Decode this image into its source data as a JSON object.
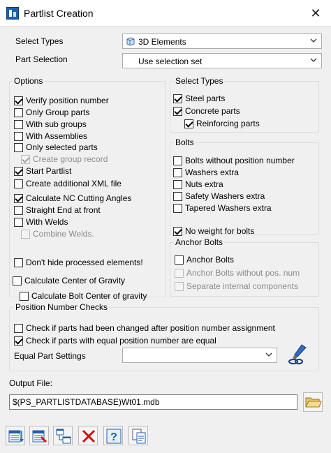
{
  "window": {
    "title": "Partlist Creation"
  },
  "top": {
    "select_types_label": "Select Types",
    "select_types_value": "3D Elements",
    "part_selection_label": "Part Selection",
    "part_selection_value": "Use selection set"
  },
  "options": {
    "title": "Options",
    "items": [
      {
        "label": "Verify position number",
        "checked": true,
        "enabled": true
      },
      {
        "label": "Only Group parts",
        "checked": false,
        "enabled": true
      },
      {
        "label": "With sub groups",
        "checked": false,
        "enabled": true
      },
      {
        "label": "With Assemblies",
        "checked": false,
        "enabled": true
      },
      {
        "label": "Only selected parts",
        "checked": false,
        "enabled": true
      },
      {
        "label": "Create group record",
        "checked": true,
        "enabled": false
      },
      {
        "label": "Start Partlist",
        "checked": true,
        "enabled": true
      },
      {
        "label": "Create additional XML file",
        "checked": false,
        "enabled": true
      },
      {
        "label": "Calculate NC Cutting Angles",
        "checked": true,
        "enabled": true
      },
      {
        "label": "Straight End at front",
        "checked": false,
        "enabled": true
      },
      {
        "label": "With Welds",
        "checked": false,
        "enabled": true
      },
      {
        "label": "Combine Welds.",
        "checked": false,
        "enabled": false
      },
      {
        "label": "Don't hide processed elements!",
        "checked": false,
        "enabled": true
      },
      {
        "label": "Calculate Center of Gravity",
        "checked": false,
        "enabled": true
      },
      {
        "label": "Calculate Bolt Center of gravity",
        "checked": false,
        "enabled": true
      }
    ]
  },
  "select_types": {
    "title": "Select Types",
    "items": [
      {
        "label": "Steel parts",
        "checked": true,
        "enabled": true
      },
      {
        "label": "Concrete parts",
        "checked": true,
        "enabled": true
      },
      {
        "label": "Reinforcing parts",
        "checked": true,
        "enabled": true
      }
    ]
  },
  "bolts": {
    "title": "Bolts",
    "items": [
      {
        "label": "Bolts without position number",
        "checked": false,
        "enabled": true
      },
      {
        "label": "Washers extra",
        "checked": false,
        "enabled": true
      },
      {
        "label": "Nuts extra",
        "checked": false,
        "enabled": true
      },
      {
        "label": "Safety Washers extra",
        "checked": false,
        "enabled": true
      },
      {
        "label": "Tapered Washers extra",
        "checked": false,
        "enabled": true
      },
      {
        "label": "No weight for bolts",
        "checked": true,
        "enabled": true
      }
    ]
  },
  "anchor_bolts": {
    "title": "Anchor Bolts",
    "items": [
      {
        "label": "Anchor Bolts",
        "checked": false,
        "enabled": true
      },
      {
        "label": "Anchor Bolts without pos. num",
        "checked": false,
        "enabled": false
      },
      {
        "label": "Separate internal components",
        "checked": false,
        "enabled": false
      }
    ]
  },
  "position_checks": {
    "title": "Position Number Checks",
    "items": [
      {
        "label": "Check if parts had been changed after position number assignment",
        "checked": false,
        "enabled": true
      },
      {
        "label": "Check if parts with equal position number are equal",
        "checked": true,
        "enabled": true
      }
    ],
    "equal_part_settings_label": "Equal Part Settings",
    "equal_part_settings_value": ""
  },
  "output": {
    "label": "Output File:",
    "value": "$(PS_PARTLISTDATABASE)Wt01.mdb"
  },
  "icons": {
    "app": "partlist-app-icon",
    "close": "close-icon",
    "combo": "chevron-down-icon",
    "cube": "cube-3d-icon",
    "brush": "paint-brush-settings-icon",
    "folder": "folder-open-icon",
    "toolbar": [
      "partlist-list-icon",
      "partlist-edit-icon",
      "partlist-tree-icon",
      "cancel-x-icon",
      "help-icon",
      "copy-document-icon"
    ]
  },
  "colors": {
    "accent_blue": "#1f5fa8",
    "cancel_red": "#d01010",
    "window_bg": "#f0f0f0"
  }
}
